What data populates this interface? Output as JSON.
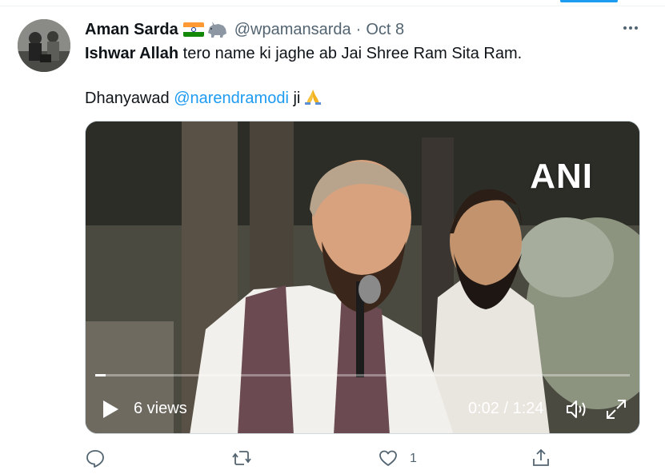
{
  "tweet": {
    "author_name": "Aman Sarda",
    "handle": "@wpamansarda",
    "separator": "·",
    "date": "Oct 8",
    "text_bold": "Ishwar Allah",
    "text_rest": " tero name ki jaghe ab Jai Shree Ram Sita Ram.",
    "line2_prefix": "Dhanyawad ",
    "mention": "@narendramodi",
    "line2_suffix": " ji",
    "emoji_name": "folded-hands",
    "flag_name": "india-flag",
    "badge_emoji_name": "rhino"
  },
  "video": {
    "watermark": "ANI",
    "views": "6 views",
    "time": "0:02 / 1:24",
    "progress": 0.02
  },
  "actions": {
    "like_count": "1"
  },
  "colors": {
    "accent": "#1d9bf0",
    "muted": "#536471",
    "text": "#0f1419"
  }
}
